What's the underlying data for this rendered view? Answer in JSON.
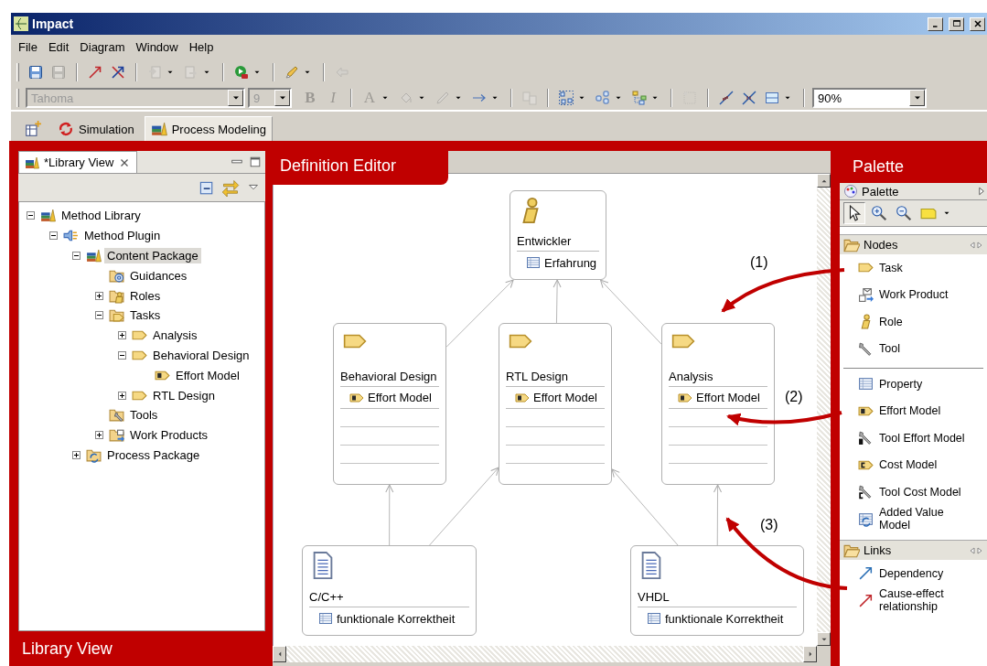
{
  "window": {
    "title": "Impact"
  },
  "menu": [
    {
      "label": "File"
    },
    {
      "label": "Edit"
    },
    {
      "label": "Diagram"
    },
    {
      "label": "Window"
    },
    {
      "label": "Help"
    }
  ],
  "toolbars": [
    {
      "items": [
        {
          "kind": "save",
          "disabled": false,
          "dropdown": false
        },
        {
          "kind": "save-all",
          "disabled": true,
          "dropdown": false
        },
        {
          "kind": "separator"
        },
        {
          "kind": "cause-arrow",
          "disabled": false,
          "dropdown": false
        },
        {
          "kind": "delete-link",
          "disabled": false,
          "dropdown": false
        },
        {
          "kind": "separator"
        },
        {
          "kind": "import",
          "disabled": true,
          "dropdown": true
        },
        {
          "kind": "export",
          "disabled": true,
          "dropdown": true
        },
        {
          "kind": "separator"
        },
        {
          "kind": "run",
          "disabled": false,
          "dropdown": true
        },
        {
          "kind": "separator"
        },
        {
          "kind": "brush",
          "disabled": false,
          "dropdown": true
        },
        {
          "kind": "separator"
        },
        {
          "kind": "back",
          "disabled": true,
          "dropdown": false
        }
      ]
    },
    {
      "items": [
        {
          "kind": "font-combo",
          "value": "Tahoma",
          "disabled": true
        },
        {
          "kind": "size-combo",
          "value": "9",
          "disabled": true
        },
        {
          "kind": "bold",
          "label": "B",
          "disabled": true,
          "dropdown": false
        },
        {
          "kind": "italic",
          "label": "I",
          "disabled": true,
          "dropdown": false
        },
        {
          "kind": "separator"
        },
        {
          "kind": "font-color",
          "label": "A",
          "disabled": true,
          "dropdown": true
        },
        {
          "kind": "fill-color",
          "disabled": true,
          "dropdown": true
        },
        {
          "kind": "line-color",
          "disabled": true,
          "dropdown": true
        },
        {
          "kind": "line-style",
          "disabled": false,
          "dropdown": true
        },
        {
          "kind": "separator"
        },
        {
          "kind": "copy-format",
          "disabled": true,
          "dropdown": false
        },
        {
          "kind": "separator"
        },
        {
          "kind": "select-all",
          "disabled": false,
          "dropdown": true
        },
        {
          "kind": "arrange",
          "disabled": false,
          "dropdown": true
        },
        {
          "kind": "layout",
          "disabled": false,
          "dropdown": true
        },
        {
          "kind": "separator"
        },
        {
          "kind": "snap",
          "disabled": true,
          "dropdown": false
        },
        {
          "kind": "separator"
        },
        {
          "kind": "link-style",
          "disabled": false,
          "dropdown": false
        },
        {
          "kind": "unlink-style",
          "disabled": false,
          "dropdown": false
        },
        {
          "kind": "panels",
          "disabled": false,
          "dropdown": true
        },
        {
          "kind": "separator"
        },
        {
          "kind": "zoom-combo",
          "value": "90%",
          "disabled": false
        }
      ]
    }
  ],
  "perspectives": [
    {
      "kind": "new-perspective",
      "selected": false
    },
    {
      "kind": "simulation",
      "label": "Simulation",
      "selected": false
    },
    {
      "kind": "modeling",
      "label": "Process Modeling",
      "selected": true
    }
  ],
  "annotations": {
    "library_view": "Library View",
    "definition_editor": "Definition Editor",
    "palette": "Palette",
    "callouts": [
      {
        "label": "(1)"
      },
      {
        "label": "(2)"
      },
      {
        "label": "(3)"
      }
    ]
  },
  "library_view": {
    "tab": {
      "label": "*Library View",
      "selected": true
    },
    "tree": [
      {
        "label": "Method Library",
        "kind": "library",
        "expanded": true,
        "selected": false,
        "children": [
          {
            "label": "Method Plugin",
            "kind": "plugin",
            "expanded": true,
            "selected": false,
            "children": [
              {
                "label": "Content Package",
                "kind": "library",
                "expanded": true,
                "selected": true,
                "children": [
                  {
                    "label": "Guidances",
                    "kind": "guidance-folder",
                    "selected": false
                  },
                  {
                    "label": "Roles",
                    "kind": "role-folder",
                    "expanded": false,
                    "selected": false
                  },
                  {
                    "label": "Tasks",
                    "kind": "task-folder",
                    "expanded": true,
                    "selected": false,
                    "children": [
                      {
                        "label": "Analysis",
                        "kind": "task",
                        "expanded": false,
                        "selected": false
                      },
                      {
                        "label": "Behavioral Design",
                        "kind": "task",
                        "expanded": true,
                        "selected": false,
                        "children": [
                          {
                            "label": "Effort Model",
                            "kind": "effort",
                            "selected": false
                          }
                        ]
                      },
                      {
                        "label": "RTL Design",
                        "kind": "task",
                        "expanded": false,
                        "selected": false
                      }
                    ]
                  },
                  {
                    "label": "Tools",
                    "kind": "tool-folder",
                    "selected": false
                  },
                  {
                    "label": "Work Products",
                    "kind": "workproduct-folder",
                    "expanded": false,
                    "selected": false
                  }
                ]
              },
              {
                "label": "Process Package",
                "kind": "process-folder",
                "expanded": false,
                "selected": false
              }
            ]
          }
        ]
      }
    ]
  },
  "diagram": {
    "nodes": [
      {
        "kind": "role",
        "name": "Entwickler",
        "properties": [
          {
            "kind": "property",
            "label": "Erfahrung"
          }
        ]
      },
      {
        "kind": "task",
        "name": "Behavioral Design",
        "properties": [
          {
            "kind": "effort",
            "label": "Effort Model"
          }
        ]
      },
      {
        "kind": "task",
        "name": "RTL Design",
        "properties": [
          {
            "kind": "effort",
            "label": "Effort Model"
          }
        ]
      },
      {
        "kind": "task",
        "name": "Analysis",
        "properties": [
          {
            "kind": "effort",
            "label": "Effort Model"
          }
        ]
      },
      {
        "kind": "work-product",
        "name": "C/C++",
        "properties": [
          {
            "kind": "property",
            "label": "funktionale Korrektheit"
          }
        ]
      },
      {
        "kind": "work-product",
        "name": "VHDL",
        "properties": [
          {
            "kind": "property",
            "label": "funktionale Korrektheit"
          }
        ]
      }
    ]
  },
  "palette": {
    "title": "Palette",
    "tools": [
      {
        "kind": "pointer",
        "selected": true
      },
      {
        "kind": "zoom-in",
        "selected": false
      },
      {
        "kind": "zoom-out",
        "selected": false
      },
      {
        "kind": "note",
        "selected": false
      }
    ],
    "drawers": [
      {
        "label": "Nodes",
        "expanded": true,
        "groups": [
          [
            {
              "kind": "task",
              "label": "Task"
            },
            {
              "kind": "work-product",
              "label": "Work Product"
            },
            {
              "kind": "role",
              "label": "Role"
            },
            {
              "kind": "tool",
              "label": "Tool"
            }
          ],
          [
            {
              "kind": "property",
              "label": "Property"
            },
            {
              "kind": "effort",
              "label": "Effort Model"
            },
            {
              "kind": "tool-effort",
              "label": "Tool Effort Model"
            },
            {
              "kind": "cost",
              "label": "Cost Model"
            },
            {
              "kind": "tool-cost",
              "label": "Tool Cost Model"
            },
            {
              "kind": "added-value",
              "label": "Added Value Model"
            }
          ]
        ]
      },
      {
        "label": "Links",
        "expanded": true,
        "groups": [
          [
            {
              "kind": "dependency",
              "label": "Dependency"
            },
            {
              "kind": "cause-effect",
              "label": "Cause-effect relationship"
            }
          ]
        ]
      }
    ]
  }
}
